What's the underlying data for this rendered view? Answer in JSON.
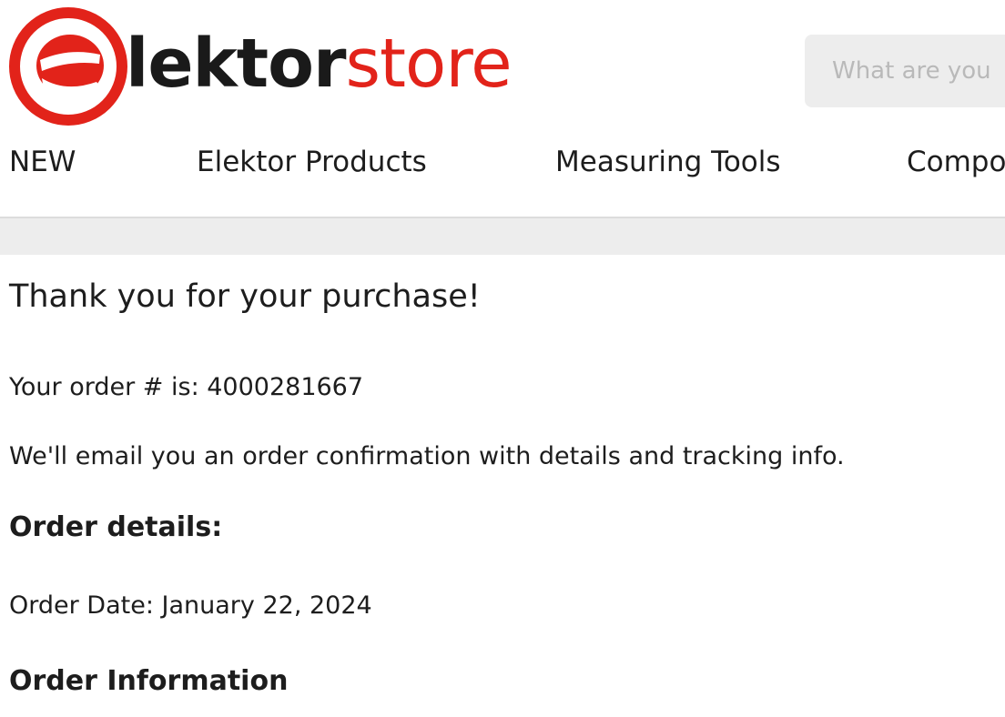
{
  "header": {
    "logo": {
      "word_dark": "lektor",
      "word_accent": "store",
      "mark_letter": "e"
    },
    "search": {
      "placeholder": "What are you"
    }
  },
  "nav": {
    "items": [
      {
        "label": "NEW"
      },
      {
        "label": "Elektor Products"
      },
      {
        "label": "Measuring Tools"
      },
      {
        "label": "Compo"
      }
    ]
  },
  "main": {
    "title": "Thank you for your purchase!",
    "order_number_text": "Your order # is: 4000281667",
    "email_notice": "We'll email you an order confirmation with details and tracking info.",
    "order_details_heading": "Order details:",
    "order_date_text": "Order Date: January 22, 2024",
    "order_information_heading": "Order Information"
  },
  "colors": {
    "brand_red": "#e2231a",
    "text_dark": "#1d1d1d",
    "band_gray": "#ededed"
  },
  "icons": {
    "logo_mark": "elektor-e-logo-icon"
  }
}
